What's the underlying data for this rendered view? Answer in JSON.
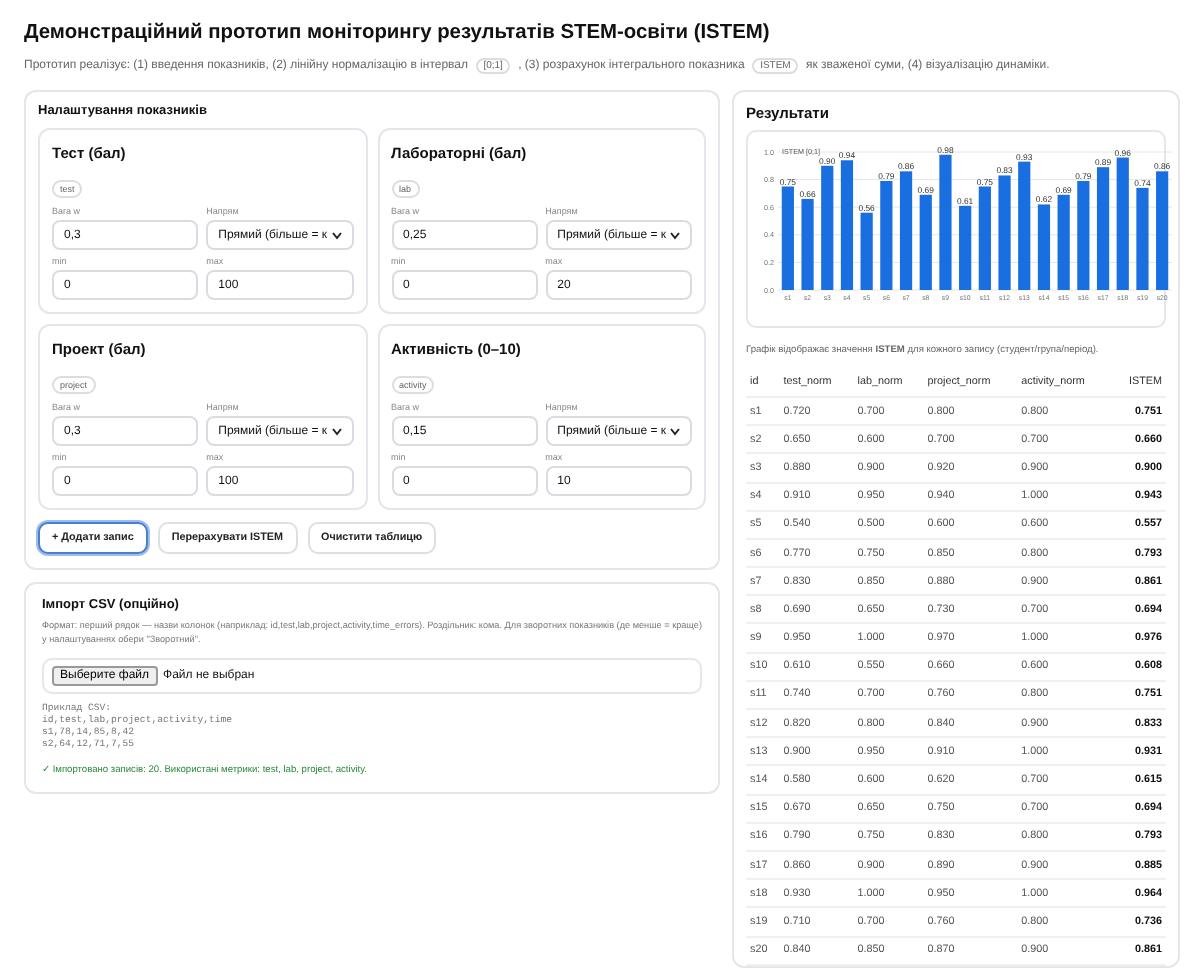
{
  "page": {
    "title": "Демонстраційний прототип моніторингу результатів STEM-освіти (ISTEM)",
    "intro": [
      {
        "kind": "text",
        "text": "Прототип реалізує: (1) введення показників, (2) лінійну нормалізацію в інтервал"
      },
      {
        "kind": "code",
        "text": "[0;1]"
      },
      {
        "kind": "text",
        "text": ", (3) розрахунок інтегрального показника"
      },
      {
        "kind": "code",
        "text": "ISTEM"
      },
      {
        "kind": "text",
        "text": "як зваженої суми, (4) візуалізацію динаміки."
      }
    ]
  },
  "settings": {
    "title": "Налаштування показників",
    "metrics": [
      {
        "title": "Тест (бал)",
        "key": "test",
        "weight_label": "Вага w",
        "weight": "0,3",
        "direction_label": "Напрям",
        "direction": "Прямий (більше = к",
        "min_label": "min",
        "min": "0",
        "max_label": "max",
        "max": "100"
      },
      {
        "title": "Лабораторні (бал)",
        "key": "lab",
        "weight_label": "Вага w",
        "weight": "0,25",
        "direction_label": "Напрям",
        "direction": "Прямий (більше = к",
        "min_label": "min",
        "min": "0",
        "max_label": "max",
        "max": "20"
      },
      {
        "title": "Проект (бал)",
        "key": "project",
        "weight_label": "Вага w",
        "weight": "0,3",
        "direction_label": "Напрям",
        "direction": "Прямий (більше = к",
        "min_label": "min",
        "min": "0",
        "max_label": "max",
        "max": "100"
      },
      {
        "title": "Активність (0–10)",
        "key": "activity",
        "weight_label": "Вага w",
        "weight": "0,15",
        "direction_label": "Напрям",
        "direction": "Прямий (більше = к",
        "min_label": "min",
        "min": "0",
        "max_label": "max",
        "max": "10"
      }
    ],
    "buttons": [
      {
        "label": "+ Додати запис",
        "selected": true
      },
      {
        "label": "Перерахувати ISTEM",
        "selected": false
      },
      {
        "label": "Очистити таблицю",
        "selected": false
      }
    ]
  },
  "import": {
    "title": "Імпорт CSV (опційно)",
    "description": "Формат: перший рядок — назви колонок (наприклад: id,test,lab,project,activity,time_errors). Роздільник: кома. Для зворотних показників (де менше = краще) у налаштуваннях обери \"Зворотний\".",
    "file_button": "Выберите файл",
    "file_status": "Файл не выбран",
    "example_label": "Приклад CSV:",
    "example_lines": [
      "id,test,lab,project,activity,time",
      "s1,78,14,85,8,42",
      "s2,64,12,71,7,55"
    ],
    "status": "✓ Імпортовано записів: 20. Використані метрики: test, lab, project, activity."
  },
  "results": {
    "title": "Результати",
    "chart_data": {
      "type": "bar",
      "title": "ISTEM [0;1]",
      "categories": [
        "s1",
        "s2",
        "s3",
        "s4",
        "s5",
        "s6",
        "s7",
        "s8",
        "s9",
        "s10",
        "s11",
        "s12",
        "s13",
        "s14",
        "s15",
        "s16",
        "s17",
        "s18",
        "s19",
        "s20"
      ],
      "series": [
        {
          "color": "#1a6fe0",
          "values": [
            0.75,
            0.66,
            0.9,
            0.94,
            0.56,
            0.79,
            0.86,
            0.69,
            0.98,
            0.61,
            0.75,
            0.83,
            0.93,
            0.62,
            0.69,
            0.79,
            0.89,
            0.96,
            0.74,
            0.86
          ]
        }
      ],
      "ylim": [
        0,
        1
      ],
      "yticks": [
        {
          "value": 0,
          "label": "0.0"
        },
        {
          "value": 0.2,
          "label": "0.2"
        },
        {
          "value": 0.4,
          "label": "0.4"
        },
        {
          "value": 0.6,
          "label": "0.6"
        },
        {
          "value": 0.8,
          "label": "0.8"
        },
        {
          "value": 1,
          "label": "1.0"
        }
      ],
      "grid": true,
      "value_labels": [
        "0.75",
        "0.66",
        "0.90",
        "0.94",
        "0.56",
        "0.79",
        "0.86",
        "0.69",
        "0.98",
        "0.61",
        "0.75",
        "0.83",
        "0.93",
        "0.62",
        "0.69",
        "0.79",
        "0.89",
        "0.96",
        "0.74",
        "0.86"
      ]
    },
    "caption": "Графік відображає значення **ISTEM** для кожного запису (студент/група/період).",
    "table": {
      "columns": [
        "id",
        "test_norm",
        "lab_norm",
        "project_norm",
        "activity_norm",
        "ISTEM"
      ],
      "rows": [
        [
          "s1",
          "0.720",
          "0.700",
          "0.800",
          "0.800",
          "0.751"
        ],
        [
          "s2",
          "0.650",
          "0.600",
          "0.700",
          "0.700",
          "0.660"
        ],
        [
          "s3",
          "0.880",
          "0.900",
          "0.920",
          "0.900",
          "0.900"
        ],
        [
          "s4",
          "0.910",
          "0.950",
          "0.940",
          "1.000",
          "0.943"
        ],
        [
          "s5",
          "0.540",
          "0.500",
          "0.600",
          "0.600",
          "0.557"
        ],
        [
          "s6",
          "0.770",
          "0.750",
          "0.850",
          "0.800",
          "0.793"
        ],
        [
          "s7",
          "0.830",
          "0.850",
          "0.880",
          "0.900",
          "0.861"
        ],
        [
          "s8",
          "0.690",
          "0.650",
          "0.730",
          "0.700",
          "0.694"
        ],
        [
          "s9",
          "0.950",
          "1.000",
          "0.970",
          "1.000",
          "0.976"
        ],
        [
          "s10",
          "0.610",
          "0.550",
          "0.660",
          "0.600",
          "0.608"
        ],
        [
          "s11",
          "0.740",
          "0.700",
          "0.760",
          "0.800",
          "0.751"
        ],
        [
          "s12",
          "0.820",
          "0.800",
          "0.840",
          "0.900",
          "0.833"
        ],
        [
          "s13",
          "0.900",
          "0.950",
          "0.910",
          "1.000",
          "0.931"
        ],
        [
          "s14",
          "0.580",
          "0.600",
          "0.620",
          "0.700",
          "0.615"
        ],
        [
          "s15",
          "0.670",
          "0.650",
          "0.750",
          "0.700",
          "0.694"
        ],
        [
          "s16",
          "0.790",
          "0.750",
          "0.830",
          "0.800",
          "0.793"
        ],
        [
          "s17",
          "0.860",
          "0.900",
          "0.890",
          "0.900",
          "0.885"
        ],
        [
          "s18",
          "0.930",
          "1.000",
          "0.950",
          "1.000",
          "0.964"
        ],
        [
          "s19",
          "0.710",
          "0.700",
          "0.760",
          "0.800",
          "0.736"
        ],
        [
          "s20",
          "0.840",
          "0.850",
          "0.870",
          "0.900",
          "0.861"
        ]
      ]
    }
  }
}
